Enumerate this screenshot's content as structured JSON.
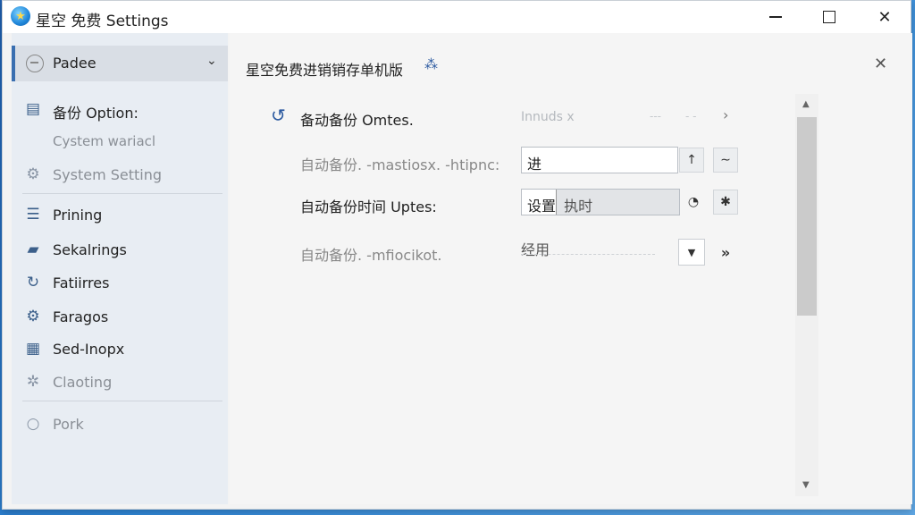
{
  "window": {
    "title": "星空 免费 Settings"
  },
  "sidebar": {
    "header_label": "Padee",
    "items": [
      {
        "label": "备份 Option:",
        "icon": "document-icon"
      },
      {
        "label": "Cystem wariacl",
        "icon": ""
      },
      {
        "label": "System Setting",
        "icon": "gear-icon"
      },
      {
        "label": "Prining",
        "icon": "list-icon"
      },
      {
        "label": "Sekalrings",
        "icon": "book-icon"
      },
      {
        "label": "Fatiirres",
        "icon": "refresh-arrow-icon"
      },
      {
        "label": "Faragos",
        "icon": "gear-icon"
      },
      {
        "label": "Sed-Inopx",
        "icon": "calendar-icon"
      },
      {
        "label": "Claoting",
        "icon": "gear-icon"
      },
      {
        "label": "Pork",
        "icon": "circle-icon"
      }
    ]
  },
  "main": {
    "title": "星空免费进销销存单机版",
    "row1": {
      "label": "备动备份 Omtes.",
      "placeholder": "Innuds x",
      "ghost1": "---",
      "ghost2": "- -",
      "chevron": "›"
    },
    "row2": {
      "label": "自动备份. -mastiosx. -htipnc:",
      "value": "进"
    },
    "row3": {
      "label": "自动备份时间 Uptes:",
      "value": "设置",
      "highlight_text": "执时"
    },
    "row4": {
      "label": "自动备份. -mfiocikot.",
      "value": "经用"
    }
  },
  "colors": {
    "accent": "#2c5aa0",
    "sidebar_bg": "#e8edf3",
    "main_bg": "#f5f5f5"
  }
}
